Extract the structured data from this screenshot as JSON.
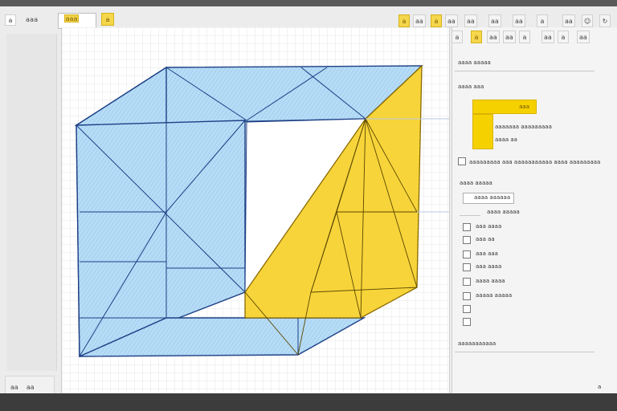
{
  "toolbar": {
    "left_label": "aaa",
    "highlight_button_label": "aaa",
    "small_label": "a",
    "icons": [
      "a",
      "aa",
      "a",
      "aa",
      "aa",
      "aa",
      "aa",
      "a",
      "aa"
    ]
  },
  "right_panel": {
    "tab_icons": [
      "a",
      "a",
      "aa",
      "aa",
      "a",
      "aa",
      "a",
      "aa"
    ],
    "section1_title": "aaaa aaaaa",
    "section2_title": "aaaa aaa",
    "yellow_swatch_label": "aaa",
    "swatch_desc_1": "aaaaaaa aaaaaaaaa",
    "swatch_desc_2": "aaaa aa",
    "toggle_label": "aaaaaaaaa aaa aaaaaaaaaaa aaaa aaaaaaaaa",
    "section3_title": "aaaa aaaaa",
    "options": [
      "aaaa aaaaaa",
      "aaaa aaaaa",
      "aaa aaaa",
      "aaa aa",
      "aaa aaa",
      "aaa aaaa",
      "aaaa aaaa",
      "aaaaa aaaaa"
    ],
    "footer_title": "aaaaaaaaaaa",
    "corner": "a"
  },
  "left_panel": {
    "btn1": "aa",
    "btn2": "aa"
  },
  "top_left_label": "a",
  "colors": {
    "accent_yellow": "#f6d100",
    "face_blue": "#a6cfee",
    "edge_blue": "#1e3a8a"
  }
}
